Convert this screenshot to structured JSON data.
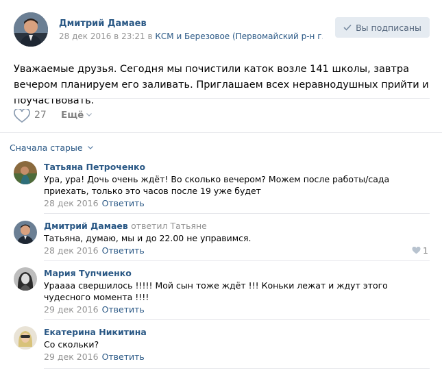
{
  "post": {
    "author": "Дмитрий Дамаев",
    "date": "28 дек 2016 в 23:21 в",
    "place": "КСМ и Березовое (Первомайский р-н г.Н...",
    "subscribe_label": "Вы подписаны",
    "text": "Уважаемые друзья. Сегодня мы почистили каток возле 141 школы, завтра вечером планируем его заливать. Приглашаем всех неравнодушных прийти и поучаствовать.",
    "likes": "27",
    "more_label": "Ещё"
  },
  "comments_sort": "Сначала старые",
  "comments": [
    {
      "author": "Татьяна Петроченко",
      "reply_to": "",
      "text": "Ура, ура! Дочь очень ждёт! Во сколько вечером? Можем после работы/сада приехать, только это часов после 19 уже будет",
      "date": "28 дек 2016",
      "answer": "Ответить",
      "likes": ""
    },
    {
      "author": "Дмитрий Дамаев",
      "reply_to": "ответил Татьяне",
      "text": "Татьяна, думаю, мы и до 22.00 не управимся.",
      "date": "28 дек 2016",
      "answer": "Ответить",
      "likes": "1"
    },
    {
      "author": "Мария Тупчиенко",
      "reply_to": "",
      "text": "Урaааа свершилось !!!!! Мой сын тоже ждёт !!! Коньки лежат и ждут этого чудесного момента !!!!",
      "date": "29 дек 2016",
      "answer": "Ответить",
      "likes": ""
    },
    {
      "author": "Екатерина Никитина",
      "reply_to": "",
      "text": "Со скольки?",
      "date": "29 дек 2016",
      "answer": "Ответить",
      "likes": ""
    }
  ],
  "colors": {
    "link": "#2a5885",
    "muted": "#939393",
    "button_bg": "#e5ebf1"
  }
}
